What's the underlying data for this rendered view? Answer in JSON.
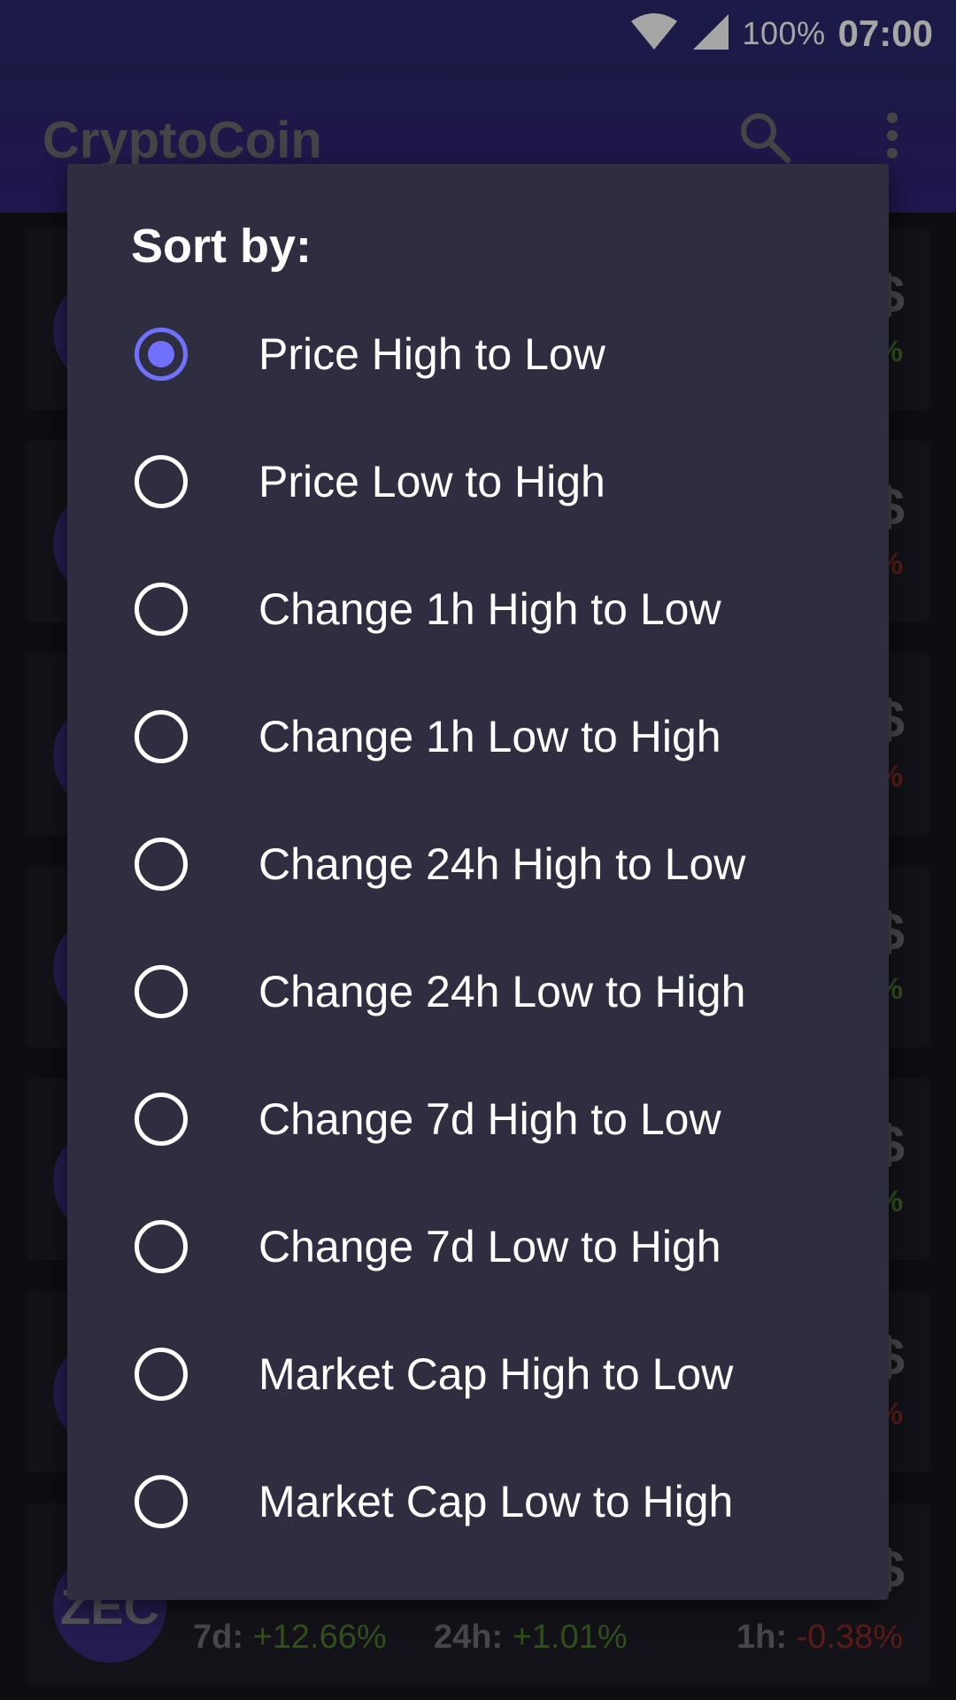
{
  "status_bar": {
    "battery": "100%",
    "time": "07:00"
  },
  "app_bar": {
    "title": "CryptoCoin",
    "icons": [
      "search-icon",
      "more-vert-icon"
    ]
  },
  "background_list": {
    "visible_card": {
      "avatar_text": "ZEC",
      "label_7d": "7d:",
      "value_7d": "+12.66%",
      "label_24h": "24h:",
      "value_24h": "+1.01%",
      "label_1h": "1h:",
      "value_1h": "-0.38%"
    },
    "partial_cards": [
      {
        "dollar": "$",
        "pct": "%",
        "trend": "up"
      },
      {
        "dollar": "$",
        "pct": "%",
        "trend": "down"
      },
      {
        "dollar": "$",
        "pct": "%",
        "trend": "down"
      },
      {
        "dollar": "$",
        "pct": "%",
        "trend": "up"
      },
      {
        "dollar": "$",
        "pct": "%",
        "trend": "up"
      },
      {
        "dollar": "$",
        "pct": "%",
        "trend": "down"
      }
    ]
  },
  "dialog": {
    "title": "Sort by:",
    "selected_index": 0,
    "options": [
      "Price High to Low",
      "Price Low to High",
      "Change 1h High to Low",
      "Change 1h Low to High",
      "Change 24h High to Low",
      "Change 24h Low to High",
      "Change 7d High to Low",
      "Change 7d Low to High",
      "Market Cap High to Low",
      "Market Cap Low to High"
    ]
  },
  "colors": {
    "accent": "#7171ff",
    "dialog_bg": "#2e2e40",
    "up": "#4a7a2a",
    "down": "#8a2a22"
  }
}
